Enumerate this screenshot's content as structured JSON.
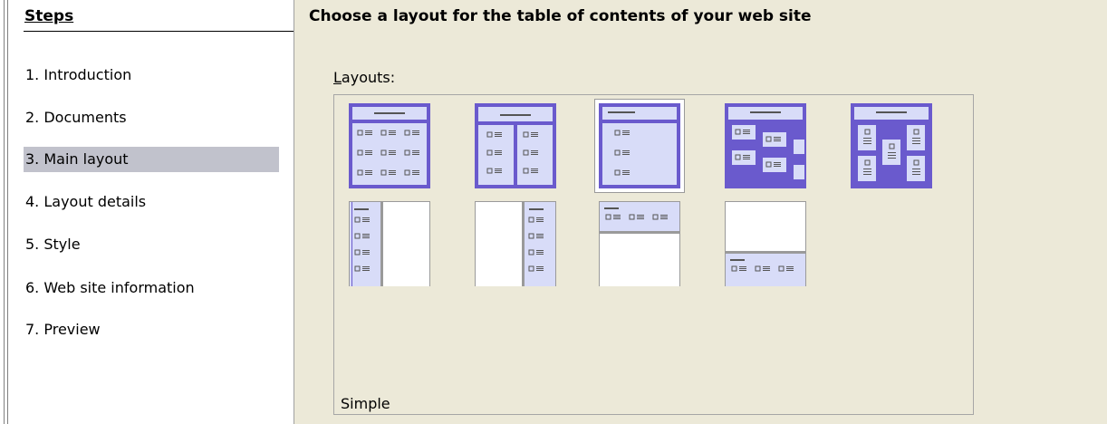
{
  "sidebar": {
    "title": "Steps",
    "items": [
      {
        "label": "1.  Introduction"
      },
      {
        "label": "2.  Documents"
      },
      {
        "label": "3.  Main layout"
      },
      {
        "label": "4.  Layout details"
      },
      {
        "label": "5.  Style"
      },
      {
        "label": "6.  Web site information"
      },
      {
        "label": "7.  Preview"
      }
    ],
    "active_index": 2
  },
  "main": {
    "title": "Choose a layout for the table of contents of your web site",
    "layouts_label_mnemonic": "L",
    "layouts_label_rest": "ayouts:",
    "selected_layout_name": "Simple"
  },
  "layouts": [
    {
      "name": "layout-table-3col"
    },
    {
      "name": "layout-table-2col"
    },
    {
      "name": "layout-simple"
    },
    {
      "name": "layout-staggered"
    },
    {
      "name": "layout-icons-centered"
    },
    {
      "name": "layout-frame-left"
    },
    {
      "name": "layout-frame-right"
    },
    {
      "name": "layout-frame-top"
    },
    {
      "name": "layout-frame-bottom"
    }
  ],
  "colors": {
    "accent": "#6a5acd",
    "thumb_fill": "#d8dcf8",
    "active_step": "#c1c2cc",
    "panel_bg": "#ece9d8"
  }
}
